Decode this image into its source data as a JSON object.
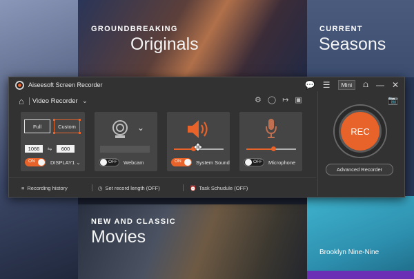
{
  "background": {
    "originals": {
      "kicker": "GROUNDBREAKING",
      "title": "Originals"
    },
    "seasons": {
      "kicker": "CURRENT",
      "title": "Seasons"
    },
    "movies": {
      "kicker": "NEW AND CLASSIC",
      "title": "Movies"
    },
    "bnn": {
      "title": "Brooklyn Nine-Nine"
    }
  },
  "window": {
    "title": "Aiseesoft Screen Recorder",
    "mini_label": "Mini",
    "mode_label": "Video Recorder"
  },
  "area": {
    "full_label": "Full",
    "custom_label": "Custom",
    "width": "1066",
    "height": "600",
    "display_toggle": "ON",
    "display_label": "DISPLAY1"
  },
  "webcam": {
    "toggle": "OFF",
    "label": "Webcam"
  },
  "system_sound": {
    "toggle": "ON",
    "label": "System Sound",
    "volume": 0.4
  },
  "microphone": {
    "toggle": "OFF",
    "label": "Microphone",
    "volume": 0.55
  },
  "rec": {
    "label": "REC",
    "advanced_label": "Advanced Recorder"
  },
  "bottom": {
    "history": "Recording history",
    "length": "Set record length (OFF)",
    "schedule": "Task Schudule (OFF)"
  },
  "colors": {
    "accent": "#e8632a",
    "window_bg": "#323232",
    "panel_bg": "#454545"
  }
}
